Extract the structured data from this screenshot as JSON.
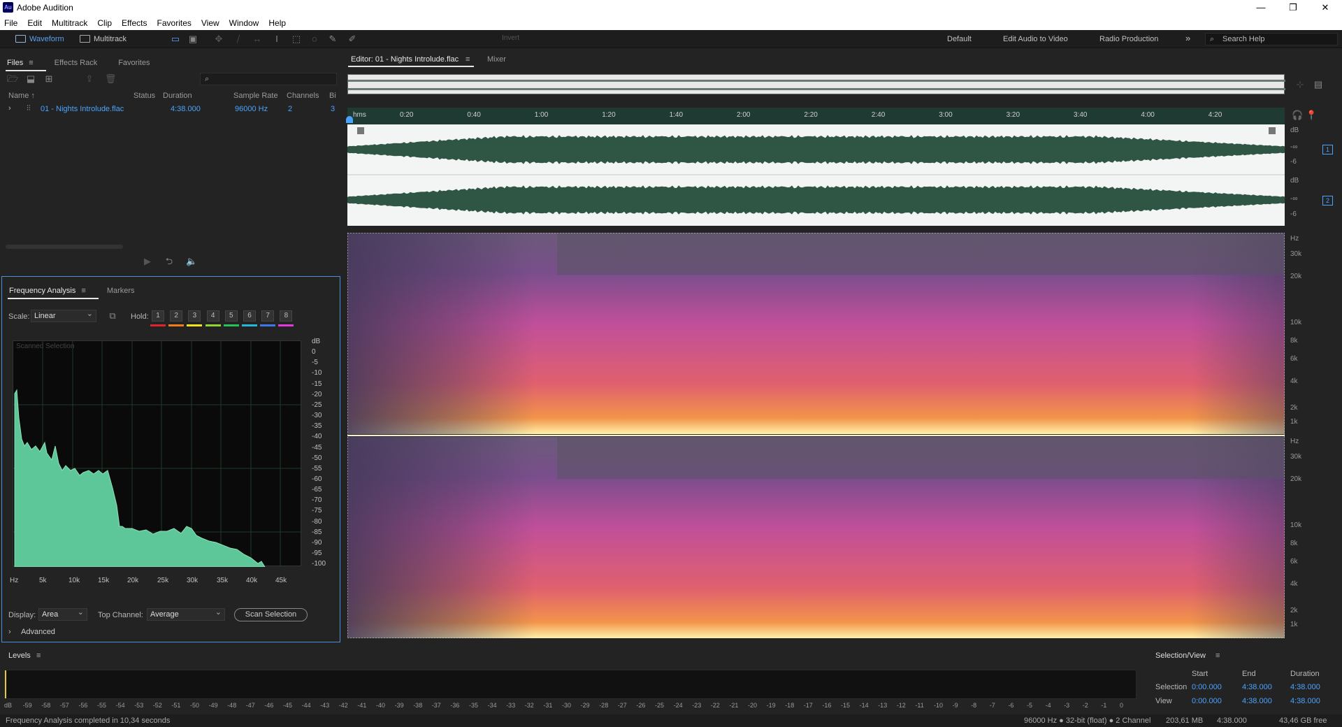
{
  "app": {
    "title": "Adobe Audition",
    "logo": "Au"
  },
  "menu": [
    "File",
    "Edit",
    "Multitrack",
    "Clip",
    "Effects",
    "Favorites",
    "View",
    "Window",
    "Help"
  ],
  "toolbar": {
    "waveform": "Waveform",
    "multitrack": "Multitrack",
    "invert": "Invert",
    "workspaces": [
      "Default",
      "Edit Audio to Video",
      "Radio Production"
    ],
    "search_placeholder": "Search Help"
  },
  "files_panel": {
    "tabs": [
      "Files",
      "Effects Rack",
      "Favorites"
    ],
    "columns": [
      "Name",
      "Status",
      "Duration",
      "Sample Rate",
      "Channels",
      "Bi"
    ],
    "rows": [
      {
        "name": "01 - Nights Introlude.flac",
        "status": "",
        "duration": "4:38.000",
        "sample_rate": "96000 Hz",
        "channels": "2",
        "bits": "3"
      }
    ]
  },
  "freq_panel": {
    "tabs": [
      "Frequency Analysis",
      "Markers"
    ],
    "scale_label": "Scale:",
    "scale_value": "Linear",
    "hold_label": "Hold:",
    "holds": [
      "1",
      "2",
      "3",
      "4",
      "5",
      "6",
      "7",
      "8"
    ],
    "hold_colors": [
      "#e0242b",
      "#f07d1a",
      "#f2e21c",
      "#8fd633",
      "#25c25a",
      "#27b7d9",
      "#3c78e8",
      "#e23ad9"
    ],
    "graph_note": "Scanned Selection",
    "db_labels": [
      "dB",
      "0",
      "-5",
      "-10",
      "-15",
      "-20",
      "-25",
      "-30",
      "-35",
      "-40",
      "-45",
      "-50",
      "-55",
      "-60",
      "-65",
      "-70",
      "-75",
      "-80",
      "-85",
      "-90",
      "-95",
      "-100"
    ],
    "hz_labels": [
      "Hz",
      "5k",
      "10k",
      "15k",
      "20k",
      "25k",
      "30k",
      "35k",
      "40k",
      "45k"
    ],
    "display_label": "Display:",
    "display_value": "Area",
    "top_channel_label": "Top Channel:",
    "top_channel_value": "Average",
    "scan_button": "Scan Selection",
    "advanced": "Advanced"
  },
  "editor": {
    "tab": "Editor: 01 - Nights Introlude.flac",
    "mixer": "Mixer",
    "timeline": [
      "hms",
      "0:20",
      "0:40",
      "1:00",
      "1:20",
      "1:40",
      "2:00",
      "2:20",
      "2:40",
      "3:00",
      "3:20",
      "3:40",
      "4:00",
      "4:20"
    ],
    "wave_ruler": [
      "dB",
      "-∞",
      "-6",
      "dB",
      "-∞",
      "-6"
    ],
    "channels": [
      "1",
      "2"
    ],
    "spec_ruler_top": [
      "Hz",
      "30k",
      "20k",
      "10k",
      "8k",
      "6k",
      "4k",
      "2k",
      "1k"
    ],
    "spec_ruler_bottom": [
      "Hz",
      "30k",
      "20k",
      "10k",
      "8k",
      "6k",
      "4k",
      "2k",
      "1k"
    ]
  },
  "levels": {
    "title": "Levels",
    "scale": [
      "dB",
      "-59",
      "-58",
      "-57",
      "-56",
      "-55",
      "-54",
      "-53",
      "-52",
      "-51",
      "-50",
      "-49",
      "-48",
      "-47",
      "-46",
      "-45",
      "-44",
      "-43",
      "-42",
      "-41",
      "-40",
      "-39",
      "-38",
      "-37",
      "-36",
      "-35",
      "-34",
      "-33",
      "-32",
      "-31",
      "-30",
      "-29",
      "-28",
      "-27",
      "-26",
      "-25",
      "-24",
      "-23",
      "-22",
      "-21",
      "-20",
      "-19",
      "-18",
      "-17",
      "-16",
      "-15",
      "-14",
      "-13",
      "-12",
      "-11",
      "-10",
      "-9",
      "-8",
      "-7",
      "-6",
      "-5",
      "-4",
      "-3",
      "-2",
      "-1",
      "0"
    ]
  },
  "selection_view": {
    "title": "Selection/View",
    "headers": [
      "Start",
      "End",
      "Duration"
    ],
    "selection_label": "Selection",
    "selection": [
      "0:00.000",
      "4:38.000",
      "4:38.000"
    ],
    "view_label": "View",
    "view": [
      "0:00.000",
      "4:38.000",
      "4:38.000"
    ]
  },
  "status": {
    "left": "Frequency Analysis completed in 10,34 seconds",
    "format": "96000 Hz ● 32-bit (float) ● 2 Channel",
    "size": "203,61 MB",
    "duration": "4:38.000",
    "free": "43,46 GB free"
  },
  "colors": {
    "accent": "#4aa3ff",
    "spectrum_fill": "#5ec79a",
    "wave": "#2f5544",
    "timeline": "#1f3a33"
  }
}
